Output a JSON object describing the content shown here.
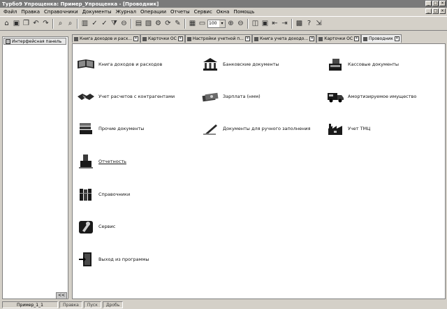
{
  "window": {
    "title": "Турбо9 Упрощенка: Пример_Упрощенка - [Проводник]",
    "min": "_",
    "max": "□",
    "close": "×"
  },
  "menu": {
    "items": [
      "Файл",
      "Правка",
      "Справочники",
      "Документы",
      "Журнал",
      "Операции",
      "Отчеты",
      "Сервис",
      "Окна",
      "Помощь"
    ]
  },
  "toolbar": {
    "zoom_value": "100"
  },
  "left_panel": {
    "tab_label": "Интерфейсная панель",
    "collapse_label": "<<"
  },
  "tabs": [
    {
      "label": "Книга доходов и расх..."
    },
    {
      "label": "Карточки ОС"
    },
    {
      "label": "Настройки учетной п..."
    },
    {
      "label": "Книга учета доходо..."
    },
    {
      "label": "Карточки ОС"
    },
    {
      "label": "Проводник",
      "active": true
    }
  ],
  "explorer": {
    "items": [
      {
        "label": "Книга доходов и расходов",
        "icon": "book-icon"
      },
      {
        "label": "Банковские документы",
        "icon": "bank-icon"
      },
      {
        "label": "Кассовые документы",
        "icon": "cash-register-icon"
      },
      {
        "label": "Учет расчетов с контрагентами",
        "icon": "handshake-icon"
      },
      {
        "label": "Зарплата (нмм)",
        "icon": "money-icon"
      },
      {
        "label": "Амортизируемое имущество",
        "icon": "truck-icon"
      },
      {
        "label": "Прочие документы",
        "icon": "documents-icon"
      },
      {
        "label": "Документы для ручного заполнения",
        "icon": "pen-icon"
      },
      {
        "label": "Учет ТМЦ",
        "icon": "factory-icon"
      },
      {
        "label": "Отчетность",
        "icon": "reports-icon"
      },
      {
        "label": "Справочники",
        "icon": "books-icon"
      },
      {
        "label": "Сервис",
        "icon": "tools-icon"
      },
      {
        "label": "Выход из программы",
        "icon": "exit-door-icon"
      }
    ]
  },
  "status": {
    "cells": [
      "Пример_1_1",
      "Правка",
      "Пуск",
      "Дробь"
    ]
  }
}
